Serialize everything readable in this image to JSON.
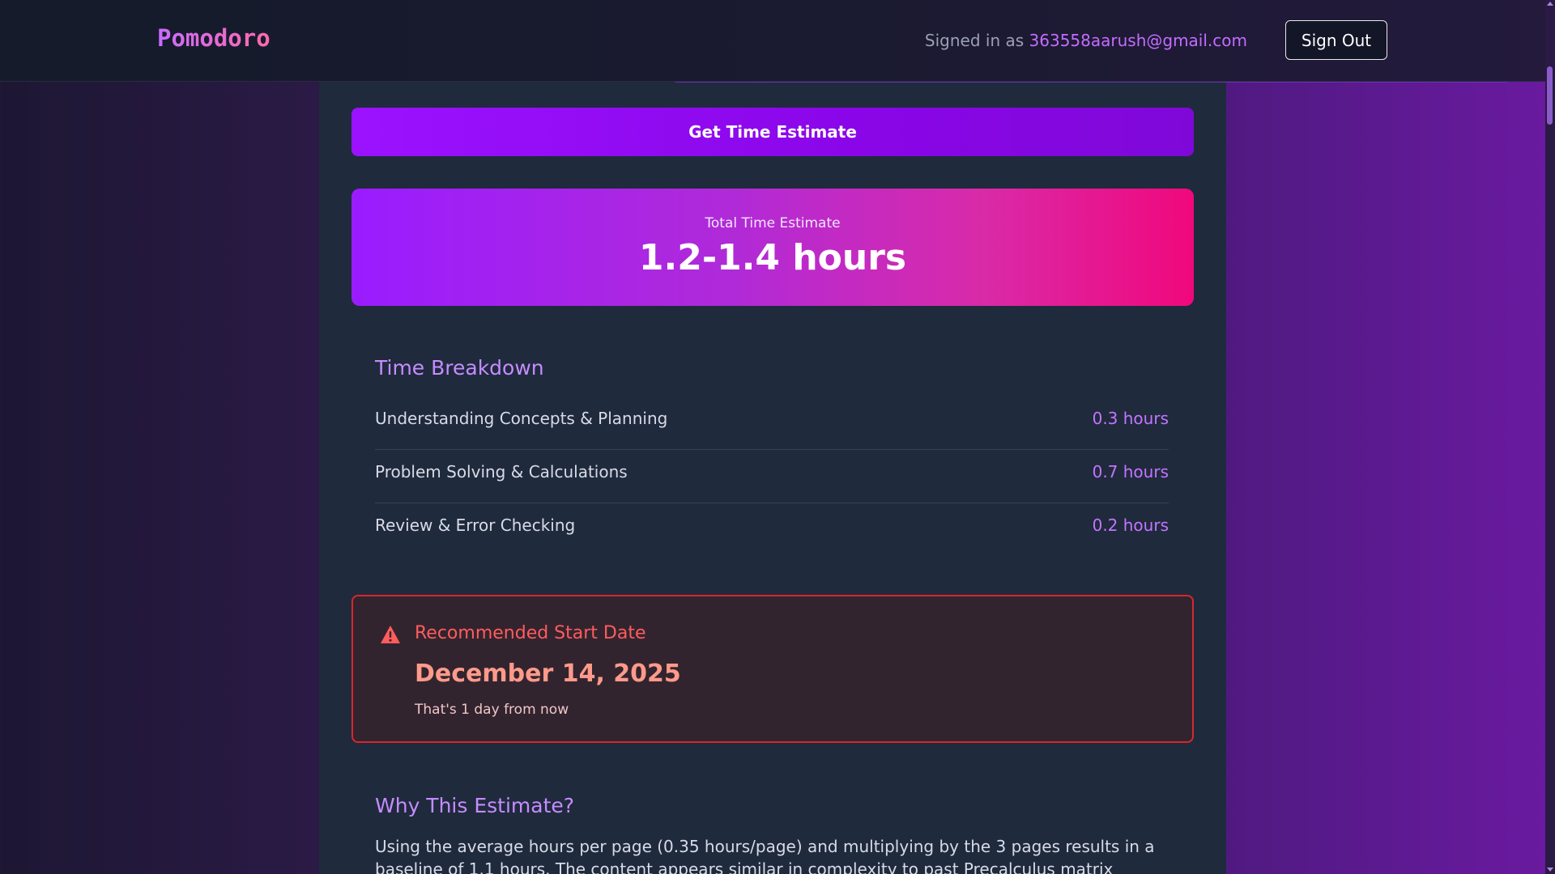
{
  "header": {
    "brand": "Pomodoro",
    "signed_in_prefix": "Signed in as",
    "email": "363558aarush@gmail.com",
    "sign_out_label": "Sign Out"
  },
  "actions": {
    "estimate_button_label": "Get Time Estimate"
  },
  "total": {
    "label": "Total Time Estimate",
    "value": "1.2-1.4 hours"
  },
  "breakdown": {
    "title": "Time Breakdown",
    "items": [
      {
        "label": "Understanding Concepts & Planning",
        "value": "0.3 hours"
      },
      {
        "label": "Problem Solving & Calculations",
        "value": "0.7 hours"
      },
      {
        "label": "Review & Error Checking",
        "value": "0.2 hours"
      }
    ]
  },
  "recommendation": {
    "title": "Recommended Start Date",
    "date": "December 14, 2025",
    "subtext": "That's 1 day from now",
    "icon": "warning-icon"
  },
  "why": {
    "title": "Why This Estimate?",
    "text": "Using the average hours per page (0.35 hours/page) and multiplying by the 3 pages results in a baseline of 1.1 hours. The content appears similar in complexity to past Precalculus matrix"
  },
  "colors": {
    "accent": "#9b12ff",
    "pink": "#f0087c",
    "alert_border": "#d8262e",
    "panel": "#1f2a3d"
  }
}
